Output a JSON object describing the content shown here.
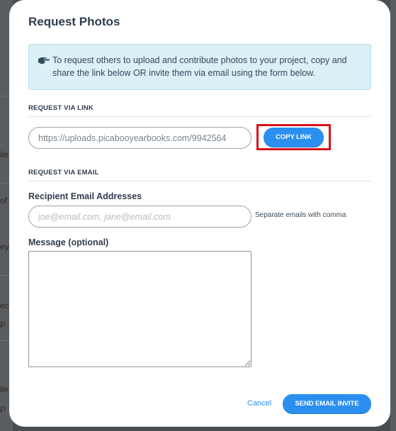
{
  "background": {
    "fragments_left": [
      "ile",
      "of",
      "ey",
      "ec",
      "P",
      "ile",
      "P"
    ]
  },
  "modal": {
    "title": "Request Photos",
    "info_text": "To request others to upload and contribute photos to your project, copy and share the link below OR invite them via email using the form below.",
    "info_icon": "pointing-hand-icon",
    "link_section": {
      "label": "REQUEST VIA LINK",
      "link_value": "https://uploads.picabooyearbooks.com/9942564",
      "copy_button_label": "COPY LINK"
    },
    "email_section": {
      "label": "REQUEST VIA EMAIL",
      "recipients_label": "Recipient Email Addresses",
      "recipients_placeholder": "joe@email.com, jane@email.com",
      "recipients_hint": "Separate emails with comma",
      "message_label": "Message (optional)",
      "message_value": ""
    },
    "footer": {
      "cancel_label": "Cancel",
      "send_label": "SEND EMAIL INVITE"
    }
  },
  "colors": {
    "accent": "#2b8ff0",
    "info_bg": "#dcf0f7",
    "highlight": "#d6121c",
    "title": "#2e3d4d"
  }
}
